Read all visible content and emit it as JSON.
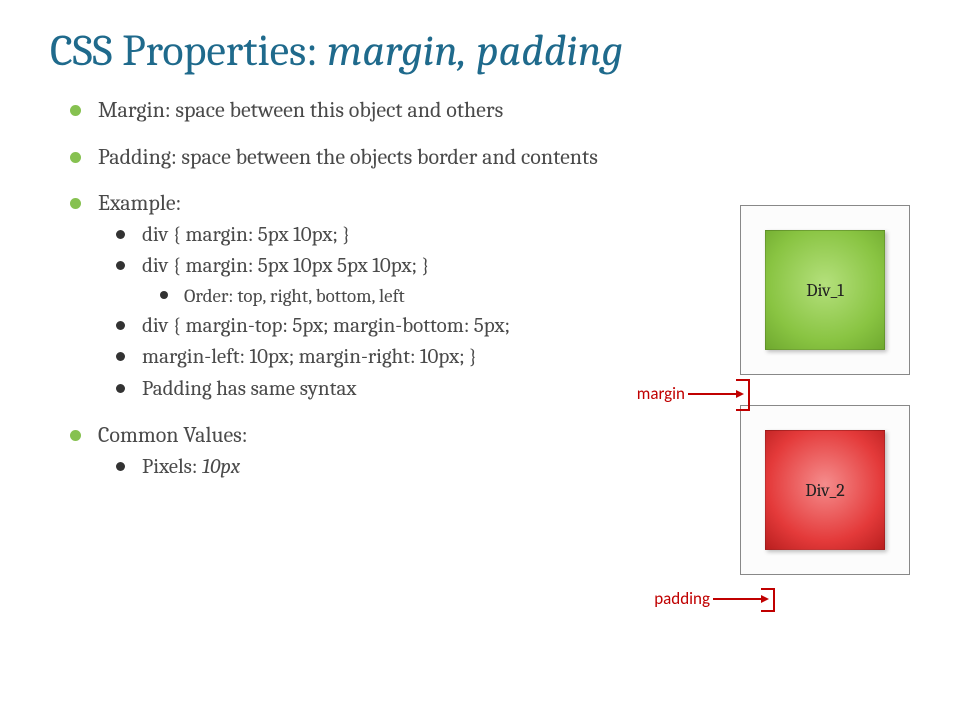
{
  "title": {
    "prefix": "CSS Properties: ",
    "italic": "margin, padding"
  },
  "bullets": {
    "b1": "Margin: space between this object and others",
    "b2": "Padding: space between the objects border and contents",
    "b3": "Example:",
    "b3sub": {
      "s1": "div { margin: 5px 10px; }",
      "s2": "div { margin: 5px 10px 5px 10px; }",
      "s2sub": "Order: top, right, bottom, left",
      "s3": "div { margin-top: 5px; margin-bottom: 5px;",
      "s4": "margin-left: 10px; margin-right: 10px; }",
      "s5": "Padding has same syntax"
    },
    "b4": "Common Values:",
    "b4sub": {
      "s1_prefix": "Pixels: ",
      "s1_italic": "10px"
    }
  },
  "diagram": {
    "div1_label": "Div_1",
    "div2_label": "Div_2",
    "margin_label": "margin",
    "padding_label": "padding"
  }
}
